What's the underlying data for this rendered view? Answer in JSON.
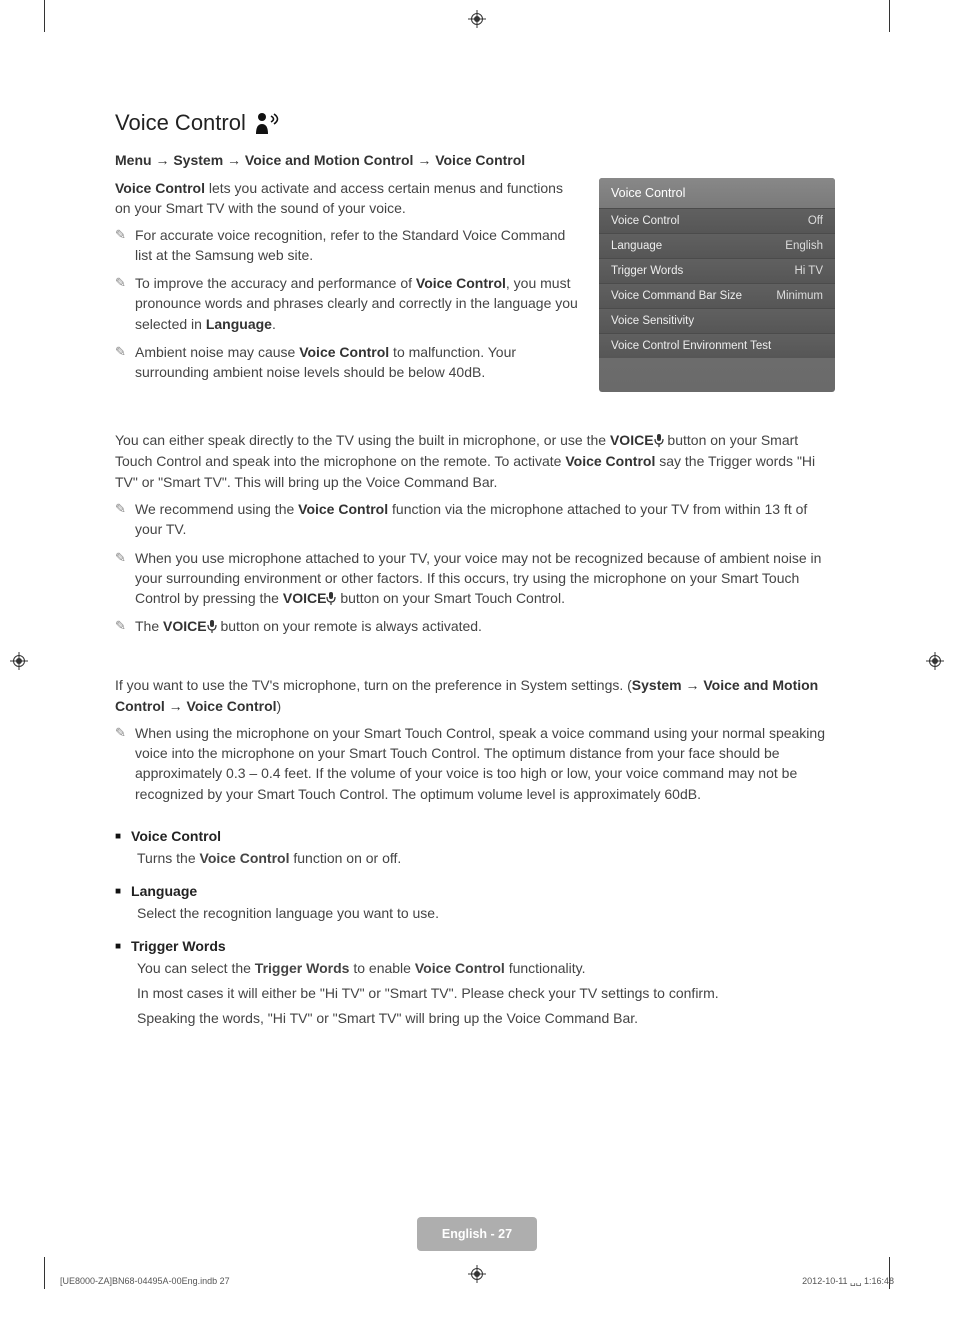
{
  "section_title": "Voice Control",
  "breadcrumb": "Menu → System → Voice and Motion Control → Voice Control",
  "intro": {
    "p1_pre": "Voice Control",
    "p1_rest": " lets you activate and access certain menus and functions on your Smart TV with the sound of your voice.",
    "notes": [
      {
        "text": "For accurate voice recognition, refer to the Standard Voice Command list at the Samsung web site."
      },
      {
        "pre": "To improve the accuracy and performance of ",
        "b1": "Voice Control",
        "mid": ", you must pronounce words and phrases clearly and correctly in the language you selected in ",
        "b2": "Language",
        "post": "."
      },
      {
        "pre": "Ambient noise may cause ",
        "b1": "Voice Control",
        "post": " to malfunction. Your surrounding ambient noise levels should be below 40dB."
      }
    ]
  },
  "menu_panel": {
    "header": "Voice Control",
    "rows": [
      {
        "label": "Voice Control",
        "value": "Off"
      },
      {
        "label": "Language",
        "value": "English"
      },
      {
        "label": "Trigger Words",
        "value": "Hi TV"
      },
      {
        "label": "Voice Command Bar Size",
        "value": "Minimum"
      },
      {
        "label": "Voice Sensitivity",
        "value": ""
      },
      {
        "label": "Voice Control Environment Test",
        "value": ""
      }
    ]
  },
  "body1": {
    "p1_pre": "You can either speak directly to the TV using the built in microphone, or use the ",
    "p1_b1": "VOICE",
    "p1_mid": " button on your Smart Touch Control and speak into the microphone on the remote. To activate ",
    "p1_b2": "Voice Control",
    "p1_post": " say the Trigger words \"Hi TV\" or \"Smart TV\". This will bring up the Voice Command Bar.",
    "notes": [
      {
        "pre": "We recommend using the ",
        "b1": "Voice Control",
        "post": " function via the microphone attached to your TV from within 13 ft of your TV."
      },
      {
        "pre": "When you use microphone attached to your TV, your voice may not be recognized because of ambient noise in your surrounding environment or other factors. If this occurs, try using the microphone on your Smart Touch Control by pressing the ",
        "b1": "VOICE",
        "mic": true,
        "post": " button on your Smart Touch Control."
      },
      {
        "pre": "The ",
        "b1": "VOICE",
        "mic": true,
        "post": " button on your remote is always activated."
      }
    ]
  },
  "body2": {
    "p1_pre": "If you want to use the TV's microphone, turn on the preference in System settings. (",
    "p1_b1": "System → Voice and Motion Control → Voice Control",
    "p1_post": ")",
    "notes": [
      {
        "text": "When using the microphone on your Smart Touch Control, speak a voice command using your normal speaking voice into the microphone on your Smart Touch Control. The optimum distance from your face should be approximately 0.3 – 0.4 feet. If the volume of your voice is too high or low, your voice command may not be recognized by your Smart Touch Control. The optimum volume level is approximately 60dB."
      }
    ]
  },
  "definitions": [
    {
      "term": "Voice Control",
      "desc": [
        "Turns the <b>Voice Control</b> function on or off."
      ]
    },
    {
      "term": "Language",
      "desc": [
        "Select the recognition language you want to use."
      ]
    },
    {
      "term": "Trigger Words",
      "desc": [
        "You can select the <b>Trigger Words</b> to enable <b>Voice Control</b> functionality.",
        "In most cases it will either be \"Hi TV\" or \"Smart TV\". Please check your TV settings to confirm.",
        "Speaking the words, \"Hi TV\" or \"Smart TV\" will bring up the Voice Command Bar."
      ]
    }
  ],
  "footer": {
    "page_label": "English - 27",
    "imprint_left": "[UE8000-ZA]BN68-04495A-00Eng.indb   27",
    "imprint_right": "2012-10-11   ␣␣ 1:16:48"
  }
}
